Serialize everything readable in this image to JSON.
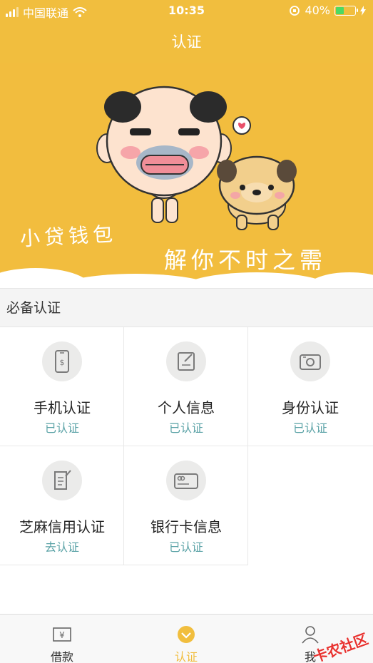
{
  "status_bar": {
    "carrier": "中国联通",
    "time": "10:35",
    "battery_percent": "40%",
    "battery_level": 0.4
  },
  "nav": {
    "title": "认证"
  },
  "banner": {
    "slogan_line1": "小贷钱包",
    "slogan_line2": "解你不时之需",
    "background_color": "#f2bd3e"
  },
  "section": {
    "title": "必备认证"
  },
  "cert_items": [
    {
      "icon": "phone-icon",
      "title": "手机认证",
      "status": "已认证"
    },
    {
      "icon": "profile-edit-icon",
      "title": "个人信息",
      "status": "已认证"
    },
    {
      "icon": "id-card-icon",
      "title": "身份认证",
      "status": "已认证"
    },
    {
      "icon": "document-icon",
      "title": "芝麻信用认证",
      "status": "去认证"
    },
    {
      "icon": "bank-card-icon",
      "title": "银行卡信息",
      "status": "已认证"
    }
  ],
  "tab_bar": {
    "tabs": [
      {
        "label": "借款",
        "icon": "loan-icon"
      },
      {
        "label": "认证",
        "icon": "verify-check-icon",
        "active": true
      },
      {
        "label": "我",
        "icon": "user-icon"
      }
    ]
  },
  "watermark": {
    "text": "卡农社区"
  },
  "colors": {
    "brand_yellow": "#f1be3e",
    "status_teal": "#5aa2a6"
  }
}
